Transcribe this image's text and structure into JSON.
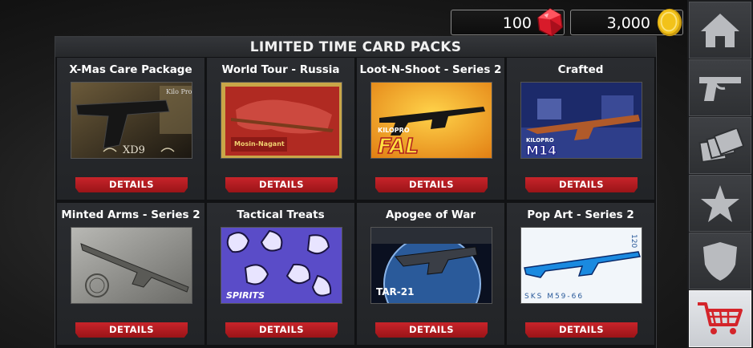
{
  "currency": {
    "gems": "100",
    "coins": "3,000"
  },
  "panel": {
    "title": "LIMITED TIME CARD PACKS"
  },
  "details_label": "DETAILS",
  "cards": [
    {
      "title": "X-Mas Care Package",
      "thumb_text": "XD9"
    },
    {
      "title": "World Tour - Russia",
      "thumb_text": "Mosin-Nagant"
    },
    {
      "title": "Loot-N-Shoot - Series 2",
      "thumb_text": "FAL"
    },
    {
      "title": "Crafted",
      "thumb_text": "M14"
    },
    {
      "title": "Minted Arms - Series 2",
      "thumb_text": ""
    },
    {
      "title": "Tactical Treats",
      "thumb_text": "SPIRITS"
    },
    {
      "title": "Apogee of War",
      "thumb_text": "TAR-21"
    },
    {
      "title": "Pop Art - Series 2",
      "thumb_text": "SKS M59-66"
    }
  ],
  "nav": [
    {
      "icon": "home-icon"
    },
    {
      "icon": "pistol-icon"
    },
    {
      "icon": "cards-icon"
    },
    {
      "icon": "star-icon"
    },
    {
      "icon": "shield-icon"
    },
    {
      "icon": "cart-icon",
      "active": true
    }
  ],
  "colors": {
    "accent_red": "#c8242a",
    "cart_red": "#d4242a",
    "gem_red": "#d81b2a",
    "coin_gold": "#f2c21a"
  }
}
